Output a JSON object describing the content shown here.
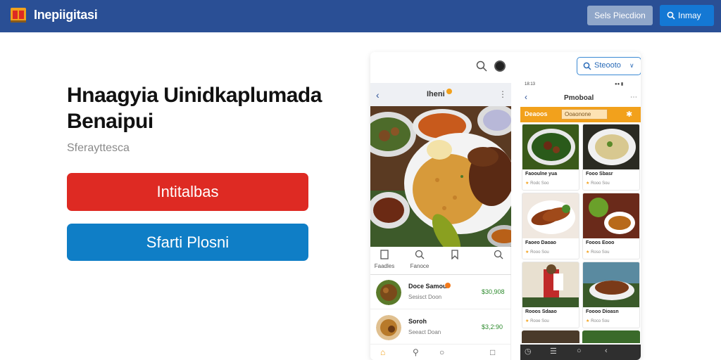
{
  "topbar": {
    "brand": "Inepiigitasi",
    "secondary_button": "Sels Piecdion",
    "primary_button": "Inmay",
    "colors": {
      "bar": "#2a4f95",
      "primary": "#1478d4"
    }
  },
  "hero": {
    "title_line1": "Hnaagyia Uinidkaplumada",
    "title_line2": "Benaipui",
    "subtitle": "Sferayttesca",
    "cta_primary": "Intitalbas",
    "cta_secondary": "Sfarti Plosni",
    "colors": {
      "cta_primary": "#de2a23",
      "cta_secondary": "#0f7ec6"
    }
  },
  "app_frame": {
    "pill_label": "Steooto",
    "icons": [
      "search-icon",
      "avatar",
      "search-icon",
      "chevron-down-icon"
    ]
  },
  "left_screen": {
    "title": "Iheni",
    "tabs": [
      {
        "label": "Faadles",
        "icon": "book-icon"
      },
      {
        "label": "Fanoce",
        "icon": "search-icon"
      },
      {
        "label": "",
        "icon": "bookmark-icon"
      },
      {
        "label": "",
        "icon": "search-icon"
      }
    ],
    "items": [
      {
        "name": "Doce Samou",
        "sub": "Sesisct Doon",
        "price": "$30,908"
      },
      {
        "name": "Soroh",
        "sub": "Seeact Doan",
        "price": "$3,2:90"
      }
    ]
  },
  "right_screen": {
    "status": "18:13",
    "title": "Pmoboal",
    "banner_label": "Deaoos",
    "banner_input": "Ooaonone",
    "cards": [
      {
        "name": "Faooulne yua",
        "meta": "Rodc Soo"
      },
      {
        "name": "Fooo Sbasr",
        "meta": "Rooo Sou"
      },
      {
        "name": "Faoeo Daoao",
        "meta": "Rooo Sou"
      },
      {
        "name": "Fooos Eooo",
        "meta": "Roso Sou"
      },
      {
        "name": "Rooos Sdaao",
        "meta": "Rooe Sou"
      },
      {
        "name": "Foooo Dioasn",
        "meta": "Roco Sou"
      }
    ]
  }
}
